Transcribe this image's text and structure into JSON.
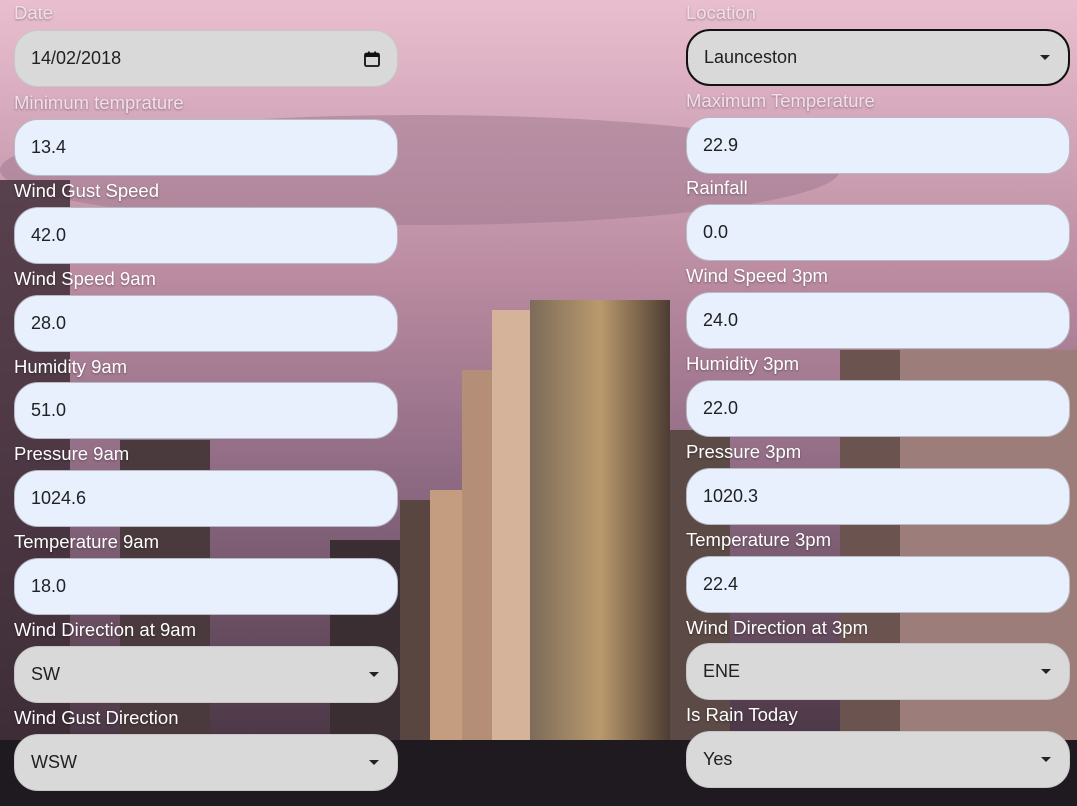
{
  "left": {
    "date": {
      "label": "Date",
      "value": "14/02/2018"
    },
    "min_temp": {
      "label": "Minimum temprature",
      "value": "13.4"
    },
    "wind_gust_speed": {
      "label": "Wind Gust Speed",
      "value": "42.0"
    },
    "wind_speed_9am": {
      "label": "Wind Speed 9am",
      "value": "28.0"
    },
    "humidity_9am": {
      "label": "Humidity 9am",
      "value": "51.0"
    },
    "pressure_9am": {
      "label": "Pressure 9am",
      "value": "1024.6"
    },
    "temperature_9am": {
      "label": "Temperature 9am",
      "value": "18.0"
    },
    "wind_dir_9am": {
      "label": "Wind Direction at 9am",
      "value": "SW"
    },
    "wind_gust_dir": {
      "label": "Wind Gust Direction",
      "value": "WSW"
    }
  },
  "right": {
    "location": {
      "label": "Location",
      "value": "Launceston"
    },
    "max_temp": {
      "label": "Maximum Temperature",
      "value": "22.9"
    },
    "rainfall": {
      "label": "Rainfall",
      "value": "0.0"
    },
    "wind_speed_3pm": {
      "label": "Wind Speed 3pm",
      "value": "24.0"
    },
    "humidity_3pm": {
      "label": "Humidity 3pm",
      "value": "22.0"
    },
    "pressure_3pm": {
      "label": "Pressure 3pm",
      "value": "1020.3"
    },
    "temperature_3pm": {
      "label": "Temperature 3pm",
      "value": "22.4"
    },
    "wind_dir_3pm": {
      "label": "Wind Direction at 3pm",
      "value": "ENE"
    },
    "rain_today": {
      "label": "Is Rain Today",
      "value": "Yes"
    }
  },
  "icons": {
    "calendar": "calendar-icon",
    "dropdown": "chevron-down-icon"
  },
  "colors": {
    "input_autofill_bg": "#e8f0fe",
    "select_bg": "#d9d9d9",
    "label_text": "#ffffff"
  }
}
